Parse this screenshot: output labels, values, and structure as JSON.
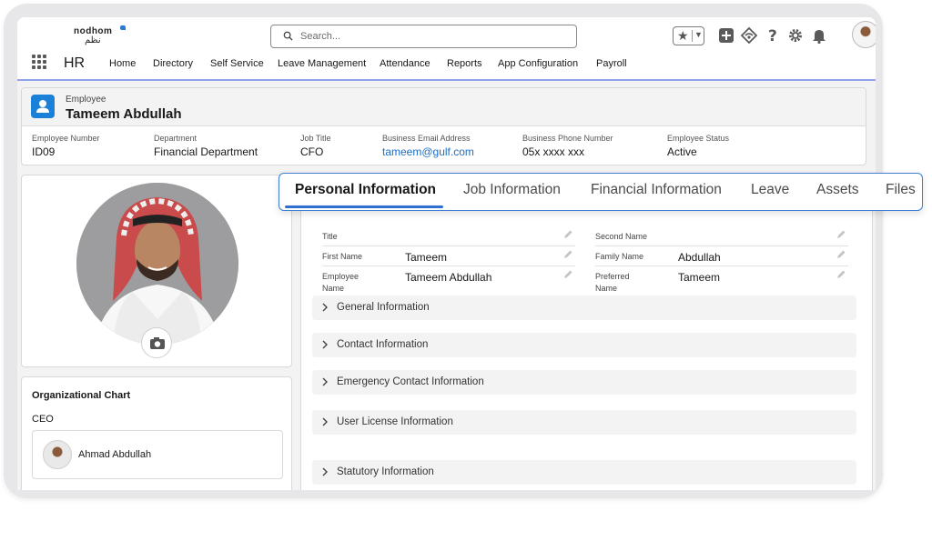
{
  "brand": {
    "logo_en": "nodhom",
    "logo_ar": "نظم"
  },
  "search": {
    "placeholder": "Search..."
  },
  "header_icons": [
    "favorites-star-icon",
    "add-icon",
    "setup-assistant-icon",
    "help-icon",
    "settings-gear-icon",
    "notifications-bell-icon",
    "user-avatar"
  ],
  "app": {
    "name": "HR",
    "nav": [
      "Home",
      "Directory",
      "Self Service",
      "Leave Management",
      "Attendance",
      "Reports",
      "App Configuration",
      "Payroll"
    ]
  },
  "record": {
    "object_label": "Employee",
    "name": "Tameem Abdullah",
    "fields": [
      {
        "label": "Employee Number",
        "value": "ID09"
      },
      {
        "label": "Department",
        "value": "Financial Department"
      },
      {
        "label": "Job Title",
        "value": "CFO"
      },
      {
        "label": "Business Email Address",
        "value": "tameem@gulf.com"
      },
      {
        "label": "Business Phone Number",
        "value": "05x xxxx xxx"
      },
      {
        "label": "Employee Status",
        "value": "Active"
      }
    ]
  },
  "org_chart": {
    "title": "Organizational Chart",
    "role": "CEO",
    "person": "Ahmad Abdullah"
  },
  "tabs": [
    "Personal Information",
    "Job Information",
    "Financial Information",
    "Leave",
    "Assets",
    "Files"
  ],
  "active_tab": "Personal Information",
  "personal": {
    "left": [
      {
        "label": "Title",
        "value": ""
      },
      {
        "label": "First Name",
        "value": "Tameem"
      },
      {
        "label": "Employee Name",
        "value": "Tameem Abdullah"
      }
    ],
    "right": [
      {
        "label": "Second Name",
        "value": ""
      },
      {
        "label": "Family Name",
        "value": "Abdullah"
      },
      {
        "label": "Preferred Name",
        "value": "Tameem"
      }
    ]
  },
  "sections": [
    "General Information",
    "Contact Information",
    "Emergency Contact Information",
    "User License Information",
    "Statutory Information"
  ],
  "colors": {
    "accent": "#1b80d8",
    "link": "#1b6fc6",
    "tab_border": "#3c7fd3",
    "nav_underline": "#8fa3ee"
  }
}
